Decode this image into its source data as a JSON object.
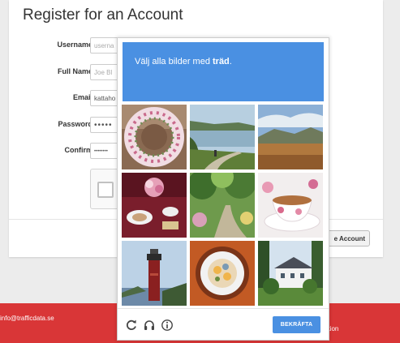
{
  "form": {
    "title": "Register for an Account",
    "fields": [
      {
        "label": "Username:",
        "value": "userna",
        "placeholder": true
      },
      {
        "label": "Full Name:",
        "value": "Joe Bl",
        "placeholder": true
      },
      {
        "label": "Email:",
        "value": "kattaho",
        "placeholder": false
      },
      {
        "label": "Password:",
        "value": "•••••",
        "placeholder": false
      },
      {
        "label": "Confirm:",
        "value": "••••••••",
        "placeholder": false
      }
    ],
    "create_button": "e Account"
  },
  "footer": {
    "email": "info@trafficdata.se",
    "right_text": "ation"
  },
  "captcha": {
    "instruction_prefix": "Välj alla bilder med ",
    "instruction_target": "träd",
    "instruction_suffix": ".",
    "verify_label": "BEKRÄFTA",
    "toolbar_icons": [
      "reload-icon",
      "audio-icon",
      "info-icon"
    ],
    "tiles": [
      {
        "name": "tile-wreath",
        "selected": false
      },
      {
        "name": "tile-lakeside-path",
        "selected": false
      },
      {
        "name": "tile-moorland",
        "selected": false
      },
      {
        "name": "tile-table-setting",
        "selected": false
      },
      {
        "name": "tile-garden-path",
        "selected": false
      },
      {
        "name": "tile-teacup",
        "selected": false
      },
      {
        "name": "tile-lighthouse",
        "selected": false
      },
      {
        "name": "tile-food-plate",
        "selected": false
      },
      {
        "name": "tile-house-trees",
        "selected": false
      }
    ]
  },
  "colors": {
    "accent": "#4a90e2",
    "footer": "#d93637"
  }
}
